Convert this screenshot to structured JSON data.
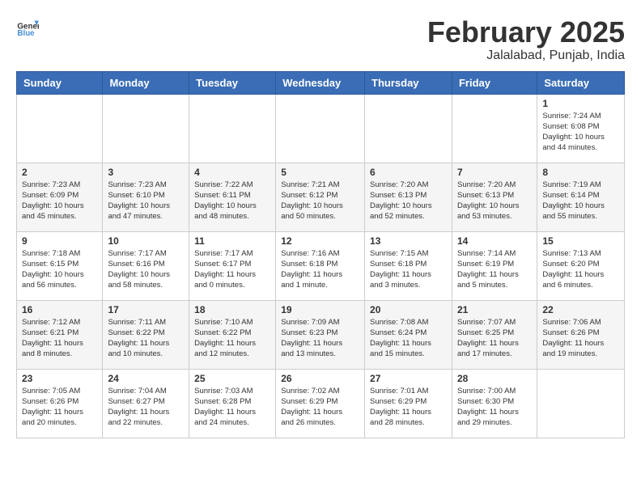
{
  "header": {
    "logo": {
      "general": "General",
      "blue": "Blue"
    },
    "title": "February 2025",
    "location": "Jalalabad, Punjab, India"
  },
  "days_of_week": [
    "Sunday",
    "Monday",
    "Tuesday",
    "Wednesday",
    "Thursday",
    "Friday",
    "Saturday"
  ],
  "weeks": [
    {
      "days": [
        {
          "number": "",
          "info": ""
        },
        {
          "number": "",
          "info": ""
        },
        {
          "number": "",
          "info": ""
        },
        {
          "number": "",
          "info": ""
        },
        {
          "number": "",
          "info": ""
        },
        {
          "number": "",
          "info": ""
        },
        {
          "number": "1",
          "info": "Sunrise: 7:24 AM\nSunset: 6:08 PM\nDaylight: 10 hours\nand 44 minutes."
        }
      ]
    },
    {
      "days": [
        {
          "number": "2",
          "info": "Sunrise: 7:23 AM\nSunset: 6:09 PM\nDaylight: 10 hours\nand 45 minutes."
        },
        {
          "number": "3",
          "info": "Sunrise: 7:23 AM\nSunset: 6:10 PM\nDaylight: 10 hours\nand 47 minutes."
        },
        {
          "number": "4",
          "info": "Sunrise: 7:22 AM\nSunset: 6:11 PM\nDaylight: 10 hours\nand 48 minutes."
        },
        {
          "number": "5",
          "info": "Sunrise: 7:21 AM\nSunset: 6:12 PM\nDaylight: 10 hours\nand 50 minutes."
        },
        {
          "number": "6",
          "info": "Sunrise: 7:20 AM\nSunset: 6:13 PM\nDaylight: 10 hours\nand 52 minutes."
        },
        {
          "number": "7",
          "info": "Sunrise: 7:20 AM\nSunset: 6:13 PM\nDaylight: 10 hours\nand 53 minutes."
        },
        {
          "number": "8",
          "info": "Sunrise: 7:19 AM\nSunset: 6:14 PM\nDaylight: 10 hours\nand 55 minutes."
        }
      ]
    },
    {
      "days": [
        {
          "number": "9",
          "info": "Sunrise: 7:18 AM\nSunset: 6:15 PM\nDaylight: 10 hours\nand 56 minutes."
        },
        {
          "number": "10",
          "info": "Sunrise: 7:17 AM\nSunset: 6:16 PM\nDaylight: 10 hours\nand 58 minutes."
        },
        {
          "number": "11",
          "info": "Sunrise: 7:17 AM\nSunset: 6:17 PM\nDaylight: 11 hours\nand 0 minutes."
        },
        {
          "number": "12",
          "info": "Sunrise: 7:16 AM\nSunset: 6:18 PM\nDaylight: 11 hours\nand 1 minute."
        },
        {
          "number": "13",
          "info": "Sunrise: 7:15 AM\nSunset: 6:18 PM\nDaylight: 11 hours\nand 3 minutes."
        },
        {
          "number": "14",
          "info": "Sunrise: 7:14 AM\nSunset: 6:19 PM\nDaylight: 11 hours\nand 5 minutes."
        },
        {
          "number": "15",
          "info": "Sunrise: 7:13 AM\nSunset: 6:20 PM\nDaylight: 11 hours\nand 6 minutes."
        }
      ]
    },
    {
      "days": [
        {
          "number": "16",
          "info": "Sunrise: 7:12 AM\nSunset: 6:21 PM\nDaylight: 11 hours\nand 8 minutes."
        },
        {
          "number": "17",
          "info": "Sunrise: 7:11 AM\nSunset: 6:22 PM\nDaylight: 11 hours\nand 10 minutes."
        },
        {
          "number": "18",
          "info": "Sunrise: 7:10 AM\nSunset: 6:22 PM\nDaylight: 11 hours\nand 12 minutes."
        },
        {
          "number": "19",
          "info": "Sunrise: 7:09 AM\nSunset: 6:23 PM\nDaylight: 11 hours\nand 13 minutes."
        },
        {
          "number": "20",
          "info": "Sunrise: 7:08 AM\nSunset: 6:24 PM\nDaylight: 11 hours\nand 15 minutes."
        },
        {
          "number": "21",
          "info": "Sunrise: 7:07 AM\nSunset: 6:25 PM\nDaylight: 11 hours\nand 17 minutes."
        },
        {
          "number": "22",
          "info": "Sunrise: 7:06 AM\nSunset: 6:26 PM\nDaylight: 11 hours\nand 19 minutes."
        }
      ]
    },
    {
      "days": [
        {
          "number": "23",
          "info": "Sunrise: 7:05 AM\nSunset: 6:26 PM\nDaylight: 11 hours\nand 20 minutes."
        },
        {
          "number": "24",
          "info": "Sunrise: 7:04 AM\nSunset: 6:27 PM\nDaylight: 11 hours\nand 22 minutes."
        },
        {
          "number": "25",
          "info": "Sunrise: 7:03 AM\nSunset: 6:28 PM\nDaylight: 11 hours\nand 24 minutes."
        },
        {
          "number": "26",
          "info": "Sunrise: 7:02 AM\nSunset: 6:29 PM\nDaylight: 11 hours\nand 26 minutes."
        },
        {
          "number": "27",
          "info": "Sunrise: 7:01 AM\nSunset: 6:29 PM\nDaylight: 11 hours\nand 28 minutes."
        },
        {
          "number": "28",
          "info": "Sunrise: 7:00 AM\nSunset: 6:30 PM\nDaylight: 11 hours\nand 29 minutes."
        },
        {
          "number": "",
          "info": ""
        }
      ]
    }
  ]
}
